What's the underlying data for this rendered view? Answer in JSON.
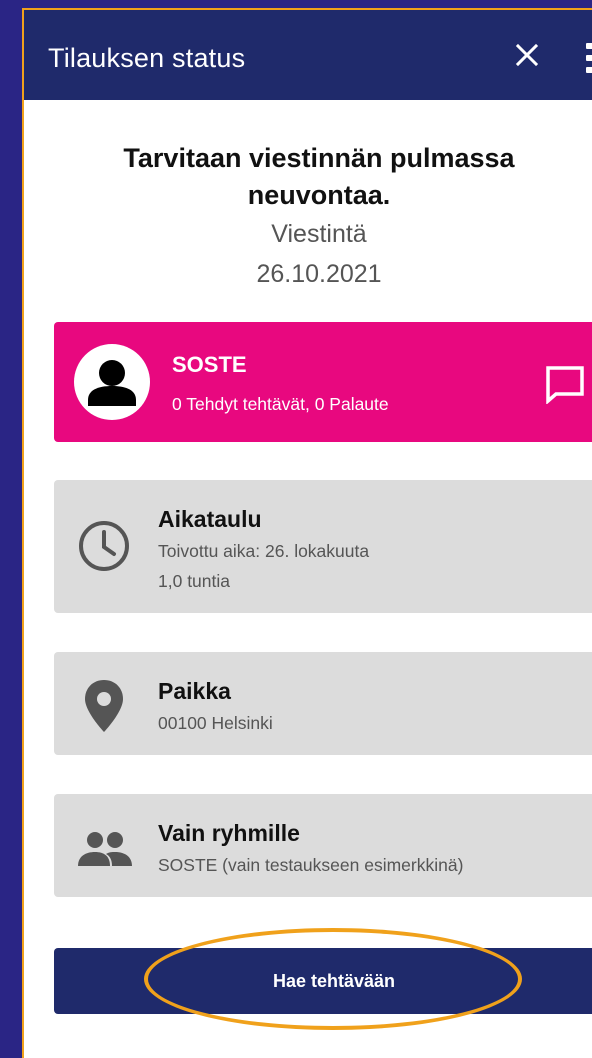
{
  "appbar": {
    "title": "Tilauksen status",
    "close_icon": "close-icon",
    "menu_icon": "more-vertical-icon"
  },
  "order": {
    "title": "Tarvitaan viestinnän pulmassa neuvontaa.",
    "category": "Viestintä",
    "date": "26.10.2021"
  },
  "organization": {
    "name": "SOSTE",
    "stats": "0 Tehdyt tehtävät, 0 Palaute",
    "avatar_icon": "person-icon",
    "message_icon": "message-icon"
  },
  "schedule": {
    "icon": "clock-icon",
    "heading": "Aikataulu",
    "preferred_time": "Toivottu aika: 26. lokakuuta",
    "duration": "1,0 tuntia"
  },
  "place": {
    "icon": "location-pin-icon",
    "heading": "Paikka",
    "address": "00100 Helsinki"
  },
  "group": {
    "icon": "people-icon",
    "heading": "Vain ryhmille",
    "description": "SOSTE (vain testaukseen esimerkkinä)"
  },
  "actions": {
    "apply_label": "Hae tehtävään"
  },
  "colors": {
    "background": "#2a2585",
    "appbar": "#1f2a6b",
    "accent_pink": "#e8087f",
    "card_grey": "#dcdcdc",
    "highlight": "#f0a11b"
  }
}
